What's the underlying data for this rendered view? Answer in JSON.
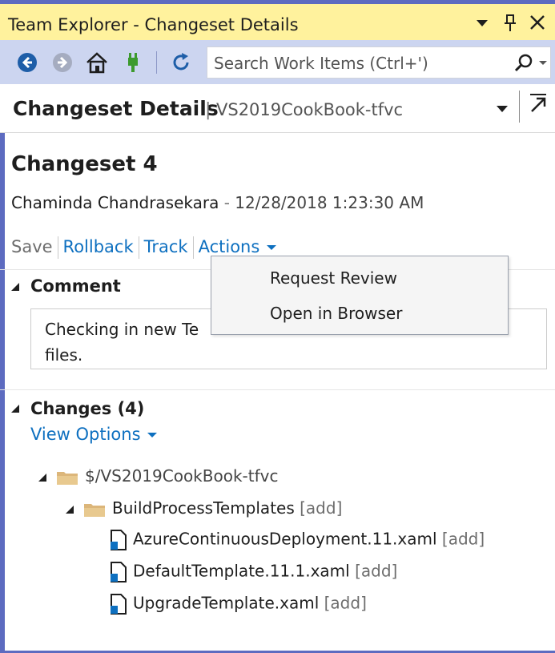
{
  "window": {
    "title": "Team Explorer - Changeset Details",
    "dropdown_glyph": "▼",
    "pin_glyph": "📌",
    "close_glyph": "✕"
  },
  "toolbar": {
    "search_placeholder": "Search Work Items (Ctrl+')",
    "icons": [
      "back-icon",
      "forward-icon",
      "home-icon",
      "connect-icon",
      "refresh-icon",
      "search-icon"
    ]
  },
  "header": {
    "title": "Changeset Details",
    "separator": "|",
    "project": "VS2019CookBook-tfvc"
  },
  "changeset": {
    "name": "Changeset 4",
    "author": "Chaminda Chandrasekara",
    "dash": "-",
    "date": "12/28/2018 1:23:30 AM"
  },
  "actions": {
    "save": "Save",
    "rollback": "Rollback",
    "track": "Track",
    "actions": "Actions"
  },
  "actions_menu": {
    "items": [
      "Request Review",
      "Open in Browser"
    ]
  },
  "comment": {
    "heading": "Comment",
    "line1": "Checking in new Te",
    "line2": "files."
  },
  "changes": {
    "heading": "Changes (4)",
    "view_options": "View Options",
    "tree": [
      {
        "label": "$/VS2019CookBook-tfvc",
        "tag": ""
      },
      {
        "label": "BuildProcessTemplates",
        "tag": "[add]"
      },
      {
        "label": "AzureContinuousDeployment.11.xaml",
        "tag": "[add]"
      },
      {
        "label": "DefaultTemplate.11.1.xaml",
        "tag": "[add]"
      },
      {
        "label": "UpgradeTemplate.xaml",
        "tag": "[add]"
      }
    ]
  },
  "colors": {
    "title_bar": "#fff29d",
    "toolbar": "#ccd5f0",
    "frame": "#5d6bc0",
    "link": "#0e70c0"
  }
}
